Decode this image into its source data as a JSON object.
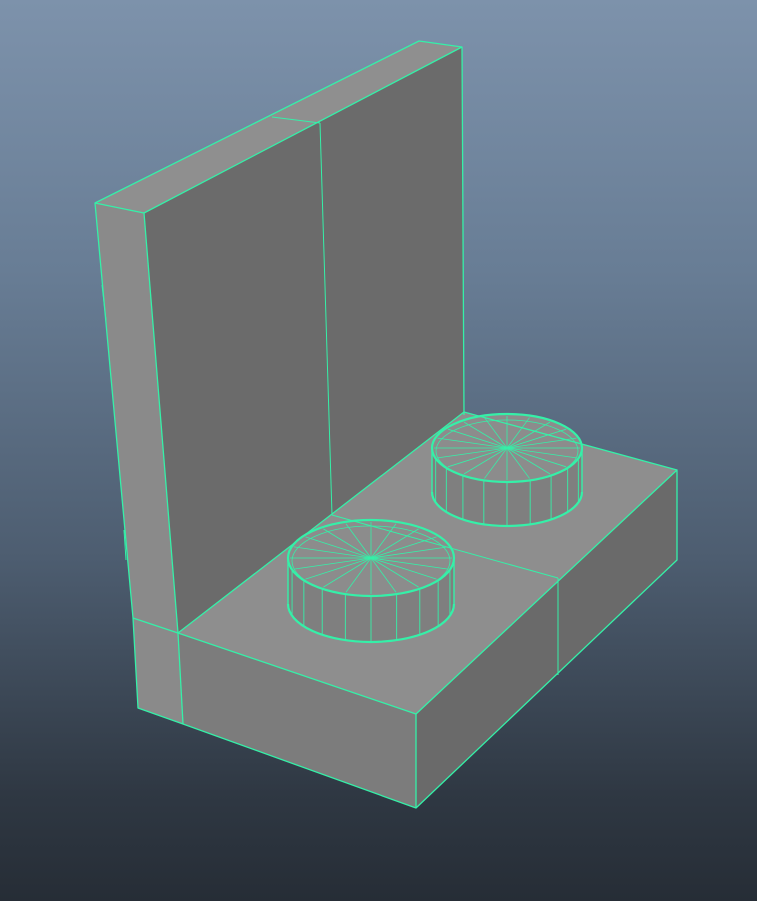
{
  "viewport": {
    "background_top": "#7d92ab",
    "background_bottom": "#262d36"
  },
  "object": {
    "kind": "lego-bracket-1x2x2",
    "selection": "selected",
    "wireframe_color": "#35f0a8",
    "shading_colors": {
      "light": "#8f8f8f",
      "medium": "#7a7a7a",
      "dark": "#6a6a6a"
    },
    "stud_count": 2,
    "stud_radial_segments": 20
  }
}
